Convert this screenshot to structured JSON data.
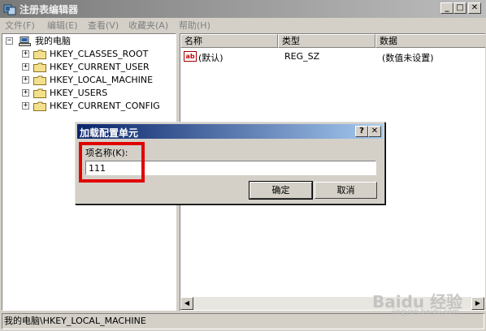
{
  "window": {
    "title": "注册表编辑器",
    "controls": {
      "minimize": "_",
      "maximize": "□",
      "close": "✕"
    }
  },
  "menu": [
    "文件(F)",
    "编辑(E)",
    "查看(V)",
    "收藏夹(A)",
    "帮助(H)"
  ],
  "tree": {
    "root": "我的电脑",
    "items": [
      "HKEY_CLASSES_ROOT",
      "HKEY_CURRENT_USER",
      "HKEY_LOCAL_MACHINE",
      "HKEY_USERS",
      "HKEY_CURRENT_CONFIG"
    ]
  },
  "list": {
    "columns": [
      "名称",
      "类型",
      "数据"
    ],
    "rows": [
      {
        "name": "(默认)",
        "type": "REG_SZ",
        "data": "(数值未设置)",
        "icon": "ab"
      }
    ]
  },
  "status": "我的电脑\\HKEY_LOCAL_MACHINE",
  "dialog": {
    "title": "加载配置单元",
    "help_glyph": "?",
    "close_glyph": "✕",
    "label": "项名称(K):",
    "value": "111",
    "ok": "确定",
    "cancel": "取消"
  },
  "colors": {
    "title_gradient": [
      "#7a7a7a",
      "#bdbdbd"
    ],
    "dialog_title_gradient": [
      "#0a246a",
      "#a6caf0"
    ],
    "highlight": "#e00000"
  },
  "watermark": {
    "main": "Baidu 经验",
    "sub": "jingyan.baidu.com"
  }
}
